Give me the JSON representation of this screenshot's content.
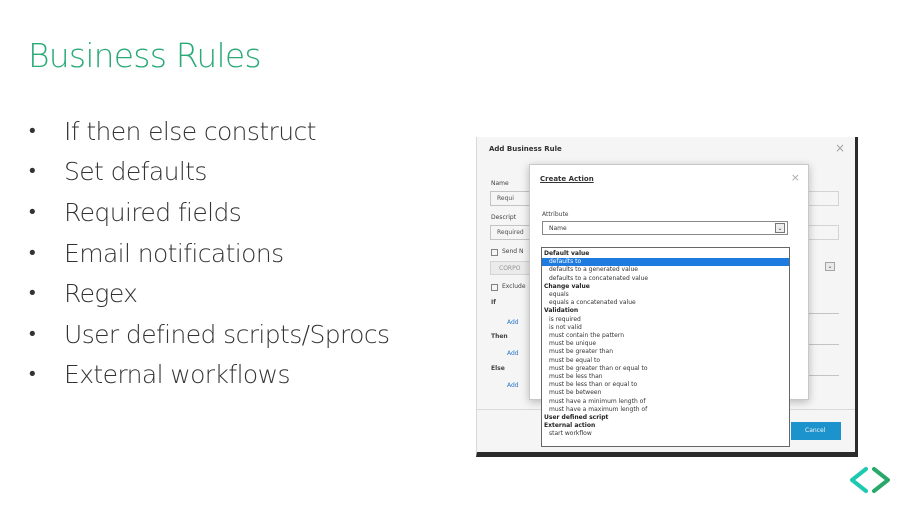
{
  "slide": {
    "title": "Business Rules",
    "bullets": [
      "If then else construct",
      "Set defaults",
      "Required fields",
      "Email notifications",
      "Regex",
      "User defined scripts/Sprocs",
      "External workflows"
    ],
    "bullet_char": "•",
    "accent_color": "#2aaa77"
  },
  "add_business_rule": {
    "title": "Add Business Rule",
    "close": "×",
    "name_label": "Name",
    "name_value": "Requi",
    "description_label": "Descript",
    "description_value": "Required",
    "send_label": "Send N",
    "select_value": "CORPO",
    "exclude_label": "Exclude",
    "if_label": "If",
    "then_label": "Then",
    "else_label": "Else",
    "add_label": "Add",
    "cancel_label": "Cancel",
    "chevron": "⌄"
  },
  "create_action": {
    "title": "Create Action",
    "close": "×",
    "attribute_label": "Attribute",
    "attribute_value": "Name",
    "arrow": "⌄"
  },
  "dropdown": {
    "groups": [
      {
        "label": "Default value",
        "options": [
          "defaults to",
          "defaults to a generated value",
          "defaults to a concatenated value"
        ]
      },
      {
        "label": "Change value",
        "options": [
          "equals",
          "equals a concatenated value"
        ]
      },
      {
        "label": "Validation",
        "options": [
          "is required",
          "is not valid",
          "must contain the pattern",
          "must be unique",
          "must be greater than",
          "must be equal to",
          "must be greater than or equal to",
          "must be less than",
          "must be less than or equal to",
          "must be between",
          "must have a minimum length of",
          "must have a maximum length of"
        ]
      },
      {
        "label": "User defined script",
        "options": []
      },
      {
        "label": "External action",
        "options": [
          "start workflow"
        ]
      }
    ],
    "selected": "defaults to"
  },
  "nav": {
    "prev_icon": "chevron-left-icon",
    "next_icon": "chevron-right-icon",
    "color_light": "#1fc8b0",
    "color_dark": "#2aa86a"
  }
}
